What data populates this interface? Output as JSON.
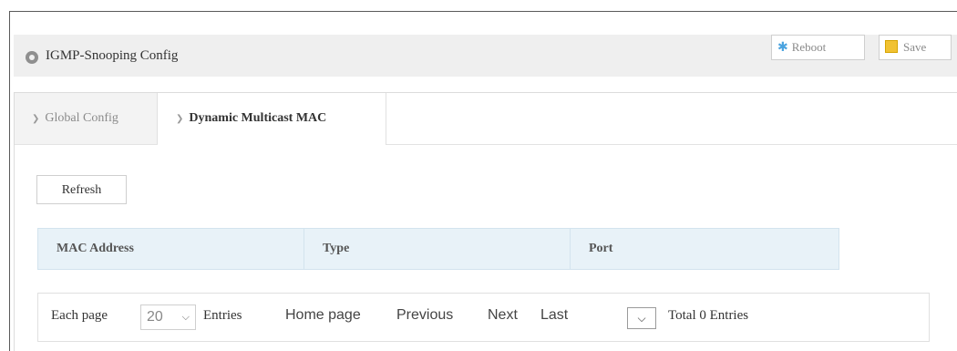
{
  "header": {
    "title": "IGMP-Snooping Config",
    "reboot_label": "Reboot",
    "save_label": "Save"
  },
  "tabs": [
    {
      "label": "Global Config",
      "active": false
    },
    {
      "label": "Dynamic Multicast MAC",
      "active": true
    }
  ],
  "toolbar": {
    "refresh_label": "Refresh"
  },
  "table": {
    "columns": [
      "MAC Address",
      "Type",
      "Port"
    ],
    "rows": []
  },
  "pager": {
    "each_page_label": "Each page",
    "page_size": "20",
    "entries_label": "Entries",
    "home": "Home page",
    "previous": "Previous",
    "next": "Next",
    "last": "Last",
    "total": "Total 0 Entries"
  },
  "colors": {
    "header_bg": "#efefef",
    "table_head_bg": "#e8f2f8",
    "reboot_icon": "#4aa3df",
    "save_icon": "#f1c232"
  }
}
